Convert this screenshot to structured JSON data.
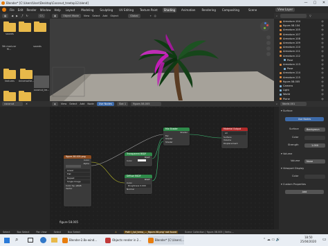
{
  "window": {
    "title": "Blender* [C:\\Users\\User\\Desktop\\Coconut_treetop12.blend]",
    "minimize": "—",
    "maximize": "▢",
    "close": "✕"
  },
  "menubar": {
    "items": [
      "File",
      "Edit",
      "Render",
      "Window",
      "Help"
    ],
    "workspaces": [
      "Layout",
      "Modeling",
      "Sculpting",
      "UV Editing",
      "Texture Paint",
      "Shading",
      "Animation",
      "Rendering",
      "Compositing"
    ],
    "active_workspace": "Shading",
    "scene": "Scene",
    "view_layer": "View Layer"
  },
  "filebrowser": {
    "path_label": "C:\\",
    "items": [
      {
        "name": "sounds",
        "kind": "folder"
      },
      {
        "name": "5th mod-car fil...",
        "kind": "folder"
      },
      {
        "name": "sounds",
        "kind": "folder"
      },
      {
        "name": "textures",
        "kind": "folder"
      },
      {
        "name": "UniversalVe...",
        "kind": "folder"
      },
      {
        "name": "coconut_tre...",
        "kind": "thumb"
      },
      {
        "name": "",
        "kind": "folder"
      },
      {
        "name": "",
        "kind": "folder"
      }
    ],
    "file_field": "coconut"
  },
  "viewport": {
    "mode": "Object Mode",
    "menus": [
      "View",
      "Select",
      "Add",
      "Object"
    ],
    "orientation": "Global",
    "palm_colors": {
      "leaves": "#0e3a12",
      "magenta": "#c21cb8",
      "trunk": "#5a3c23",
      "ground": "#a6a29a"
    }
  },
  "outliner": {
    "rows": [
      {
        "label": "Armature.104",
        "color": "#e08a3c"
      },
      {
        "label": "figure-58.104",
        "color": "#e08a3c"
      },
      {
        "label": "Armature.105",
        "color": "#e08a3c"
      },
      {
        "label": "Armature.107",
        "color": "#e08a3c"
      },
      {
        "label": "Armature.108",
        "color": "#e08a3c"
      },
      {
        "label": "Armature.109",
        "color": "#e08a3c"
      },
      {
        "label": "Armature.110",
        "color": "#e08a3c"
      },
      {
        "label": "Armature.111",
        "color": "#e08a3c"
      },
      {
        "label": "Armature.112",
        "color": "#e08a3c"
      },
      {
        "label": "Pose",
        "color": "#7fb4d8"
      },
      {
        "label": "Armature.113",
        "color": "#e08a3c"
      },
      {
        "label": "Pose",
        "color": "#7fb4d8"
      },
      {
        "label": "Armature.114",
        "color": "#e08a3c"
      },
      {
        "label": "Armature.115",
        "color": "#e08a3c"
      },
      {
        "label": "figure-58.005",
        "color": "#e08a3c"
      },
      {
        "label": "Camera",
        "color": "#7fb4d8"
      },
      {
        "label": "Light",
        "color": "#7fb4d8"
      },
      {
        "label": "World",
        "color": "#7fb4d8"
      },
      {
        "label": "Plane",
        "color": "#e08a3c"
      }
    ]
  },
  "node_editor": {
    "menus": [
      "View",
      "Select",
      "Add",
      "Node"
    ],
    "use_nodes": "Use Nodes",
    "slot": "Slot 1",
    "material": "figure-58.005",
    "object_label": "figure-58.005",
    "nodes": {
      "image_texture": {
        "title": "figure-58.005.png",
        "outputs": [
          "Color",
          "Alpha"
        ],
        "options": [
          "Linear",
          "Flat",
          "Repeat",
          "Single Image",
          "Color Sp.",
          "Vector"
        ],
        "color_space": "sRGB"
      },
      "transparent": {
        "title": "Transparent BSDF",
        "rows": [
          "BSDF",
          "Color"
        ]
      },
      "diffuse": {
        "title": "Diffuse BSDF",
        "rows": [
          "BSDF",
          "Color",
          "Roughness",
          "Normal"
        ],
        "roughness": "0.000"
      },
      "mix_shader": {
        "title": "Mix Shader",
        "rows": [
          "Shader",
          "Fac",
          "Shader",
          "Shader"
        ]
      },
      "material_output": {
        "title": "Material Output",
        "rows": [
          "All",
          "Surface",
          "Volume",
          "Displacement"
        ]
      }
    }
  },
  "properties": {
    "world_name": "World.001",
    "surface_header": "Surface",
    "use_nodes": "Use Nodes",
    "surface_label": "Surface",
    "surface_value": "Backgroun",
    "color_label": "Color",
    "strength_label": "Strength",
    "strength_value": "1.000",
    "volume_header": "Volume",
    "volume_label": "Volume",
    "volume_value": "None",
    "viewport_display": "Viewport Display",
    "vd_color_label": "Color",
    "custom_props": "Custom Properties",
    "add_label": "Add"
  },
  "statusbar": {
    "items": [
      "Select",
      "Box Select",
      "Pan View",
      "Select",
      "Box Select"
    ],
    "message": "Path \\_tpl_temp_..._figure-58.png' not found",
    "stats": "Scene Collection | figure-58.005 | Verts:..."
  },
  "taskbar": {
    "apps": [
      {
        "label": "Blender-2.8x-wind...",
        "color": "#e87d0d"
      },
      {
        "label": "Objects render in 2...",
        "color": "#c13a3a"
      },
      {
        "label": "Blender* [C:\\Users\\...",
        "color": "#e87d0d"
      }
    ],
    "time": "18:50",
    "date": "25/04/2020"
  }
}
